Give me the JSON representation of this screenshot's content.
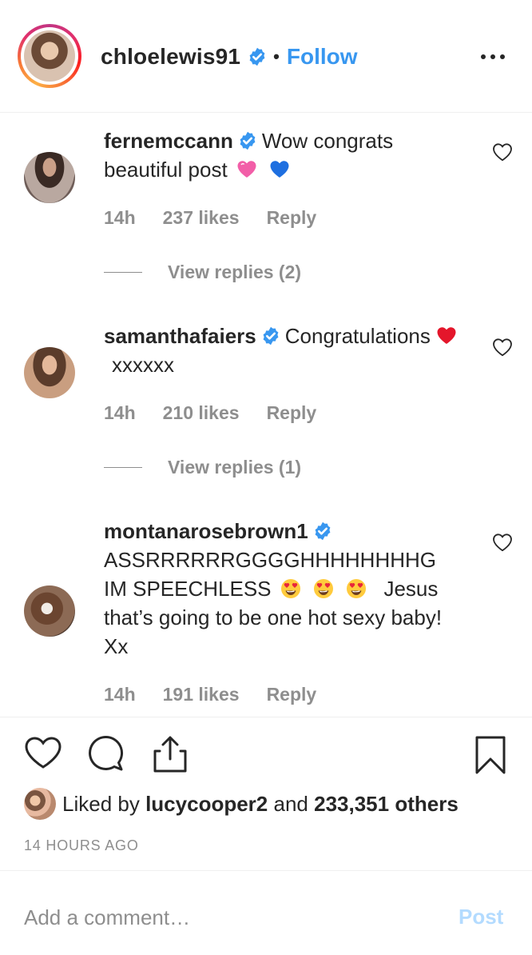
{
  "header": {
    "username": "chloelewis91",
    "separator": "•",
    "follow_label": "Follow",
    "verified_icon": "verified-badge-icon",
    "more_icon": "more-options-icon"
  },
  "comments": [
    {
      "username": "fernemccann",
      "text_before": "Wow congrats beautiful post",
      "emojis": [
        "pink-heart",
        "blue-heart"
      ],
      "text_after": "",
      "time": "14h",
      "likes": "237 likes",
      "reply_label": "Reply",
      "view_replies": "View replies (2)"
    },
    {
      "username": "samanthafaiers",
      "text_before": "Congratulations",
      "emojis": [
        "red-heart"
      ],
      "text_after": "xxxxxx",
      "time": "14h",
      "likes": "210 likes",
      "reply_label": "Reply",
      "view_replies": "View replies (1)"
    },
    {
      "username": "montanarosebrown1",
      "text_before": "ASSRRRRRRGGGGHHHHHHHHG IM SPEECHLESS",
      "emojis": [
        "heart-eyes",
        "heart-eyes",
        "heart-eyes"
      ],
      "text_after": "Jesus that’s going to be one hot sexy baby! Xx",
      "time": "14h",
      "likes": "191 likes",
      "reply_label": "Reply"
    }
  ],
  "actions": {
    "icons": [
      "like-icon",
      "comment-icon",
      "share-icon",
      "bookmark-icon"
    ],
    "liked_by_prefix": "Liked by",
    "liked_by_user": "lucycooper2",
    "liked_by_and": "and",
    "liked_by_count": "233,351 others",
    "timestamp": "14 HOURS AGO"
  },
  "add_comment": {
    "placeholder": "Add a comment…",
    "post_label": "Post"
  },
  "colors": {
    "link_blue": "#3897f0",
    "verified_blue": "#3897f0",
    "muted_gray": "#8e8e8e",
    "post_disabled": "#b3dbff"
  }
}
